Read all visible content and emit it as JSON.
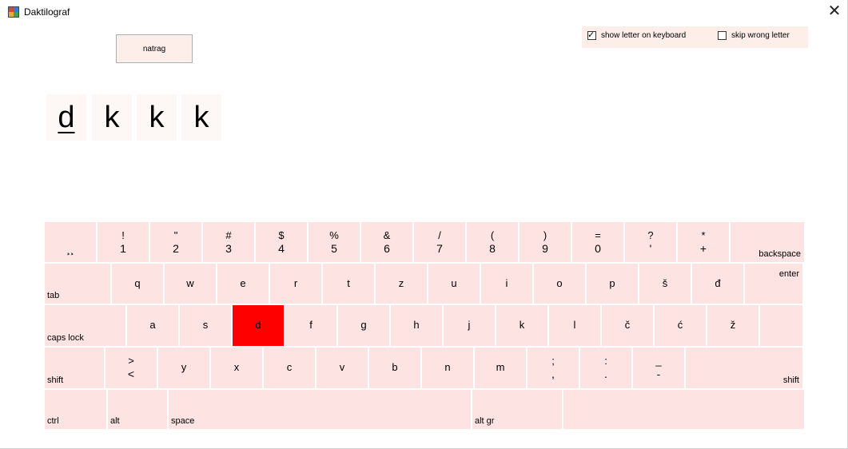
{
  "window": {
    "title": "Daktilograf",
    "close_glyph": "✕",
    "icon": "app-icon"
  },
  "controls": {
    "back_button": "natrag",
    "show_letter": {
      "label": "show letter on keyboard",
      "checked": true
    },
    "skip_wrong": {
      "label": "skip wrong letter",
      "checked": false
    }
  },
  "letters": [
    {
      "char": "d",
      "current": true
    },
    {
      "char": "k",
      "current": false
    },
    {
      "char": "k",
      "current": false
    },
    {
      "char": "k",
      "current": false
    }
  ],
  "keyboard": {
    "highlight_color": "#ff0000",
    "key_color": "#fde3e1",
    "rows": [
      [
        {
          "bot": "¸¸"
        },
        {
          "top": "!",
          "bot": "1"
        },
        {
          "top": "\"",
          "bot": "2"
        },
        {
          "top": "#",
          "bot": "3"
        },
        {
          "top": "$",
          "bot": "4"
        },
        {
          "top": "%",
          "bot": "5"
        },
        {
          "top": "&",
          "bot": "6"
        },
        {
          "top": "/",
          "bot": "7"
        },
        {
          "top": "(",
          "bot": "8"
        },
        {
          "top": ")",
          "bot": "9"
        },
        {
          "top": "=",
          "bot": "0"
        },
        {
          "top": "?",
          "bot": "'"
        },
        {
          "top": "*",
          "bot": "+"
        },
        {
          "label_br": "backspace"
        }
      ],
      [
        {
          "label_bl": "tab"
        },
        {
          "mid": "q"
        },
        {
          "mid": "w"
        },
        {
          "mid": "e"
        },
        {
          "mid": "r"
        },
        {
          "mid": "t"
        },
        {
          "mid": "z"
        },
        {
          "mid": "u"
        },
        {
          "mid": "i"
        },
        {
          "mid": "o"
        },
        {
          "mid": "p"
        },
        {
          "mid": "š"
        },
        {
          "mid": "đ"
        },
        {
          "label_tr": "enter"
        }
      ],
      [
        {
          "label_bl": "caps lock"
        },
        {
          "mid": "a"
        },
        {
          "mid": "s"
        },
        {
          "mid": "d",
          "highlight": true
        },
        {
          "mid": "f"
        },
        {
          "mid": "g"
        },
        {
          "mid": "h"
        },
        {
          "mid": "j"
        },
        {
          "mid": "k"
        },
        {
          "mid": "l"
        },
        {
          "mid": "č"
        },
        {
          "mid": "ć"
        },
        {
          "mid": "ž"
        },
        {
          "blank": true
        }
      ],
      [
        {
          "label_bl": "shift"
        },
        {
          "top": ">",
          "bot": "<"
        },
        {
          "mid": "y"
        },
        {
          "mid": "x"
        },
        {
          "mid": "c"
        },
        {
          "mid": "v"
        },
        {
          "mid": "b"
        },
        {
          "mid": "n"
        },
        {
          "mid": "m"
        },
        {
          "top": ";",
          "bot": ","
        },
        {
          "top": ":",
          "bot": "."
        },
        {
          "top": "_",
          "bot": "-"
        },
        {
          "label_br": "shift"
        }
      ],
      [
        {
          "label_bl": "ctrl"
        },
        {
          "label_bl": "alt"
        },
        {
          "label_bl": "space"
        },
        {
          "label_bl": "alt gr"
        },
        {
          "blank": true
        }
      ]
    ]
  }
}
